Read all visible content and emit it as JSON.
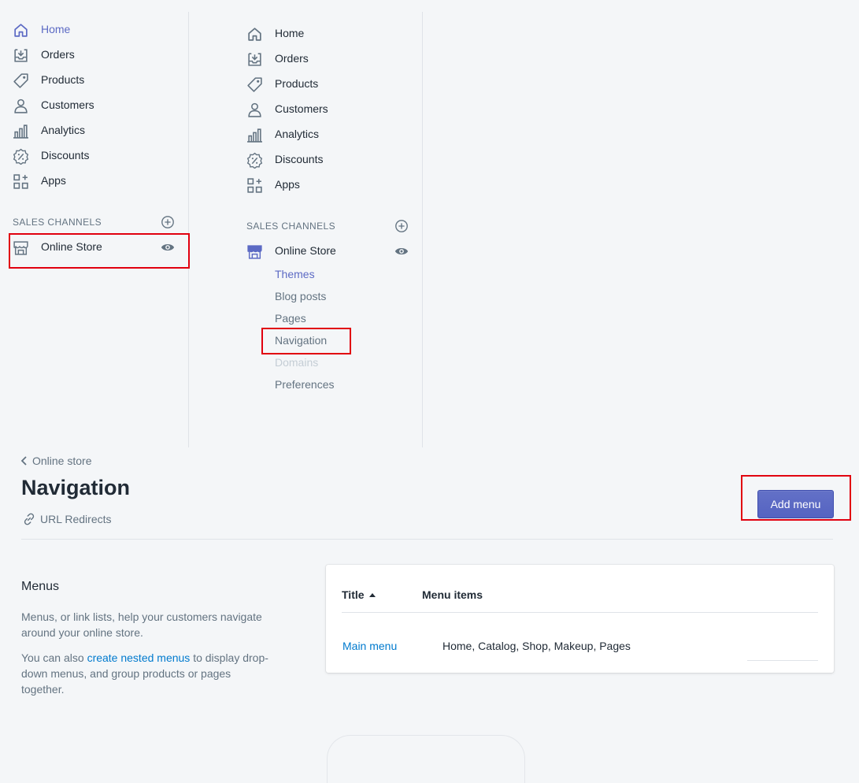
{
  "sidebar": {
    "items": [
      {
        "label": "Home",
        "icon": "home-icon"
      },
      {
        "label": "Orders",
        "icon": "orders-icon"
      },
      {
        "label": "Products",
        "icon": "products-icon"
      },
      {
        "label": "Customers",
        "icon": "customers-icon"
      },
      {
        "label": "Analytics",
        "icon": "analytics-icon"
      },
      {
        "label": "Discounts",
        "icon": "discounts-icon"
      },
      {
        "label": "Apps",
        "icon": "apps-icon"
      }
    ],
    "sales_channels_heading": "SALES CHANNELS",
    "online_store_label": "Online Store",
    "online_store_subitems": [
      {
        "label": "Themes",
        "state": "active"
      },
      {
        "label": "Blog posts",
        "state": "normal"
      },
      {
        "label": "Pages",
        "state": "normal"
      },
      {
        "label": "Navigation",
        "state": "normal"
      },
      {
        "label": "Domains",
        "state": "disabled"
      },
      {
        "label": "Preferences",
        "state": "normal"
      }
    ]
  },
  "page": {
    "breadcrumb": "Online store",
    "title": "Navigation",
    "secondary_action": "URL Redirects",
    "primary_action": "Add menu"
  },
  "menus_section": {
    "heading": "Menus",
    "description": "Menus, or link lists, help your customers navigate around your online store.",
    "nested_prefix": "You can also ",
    "nested_link": "create nested menus",
    "nested_suffix": " to display drop-down menus, and group products or pages together."
  },
  "menus_table": {
    "columns": [
      "Title",
      "Menu items"
    ],
    "rows": [
      {
        "title": "Main menu",
        "items": "Home, Catalog, Shop, Makeup, Pages"
      }
    ]
  },
  "colors": {
    "accent": "#5c6ac4",
    "link": "#007ace",
    "highlight": "#e1000f",
    "background": "#f4f6f8"
  }
}
